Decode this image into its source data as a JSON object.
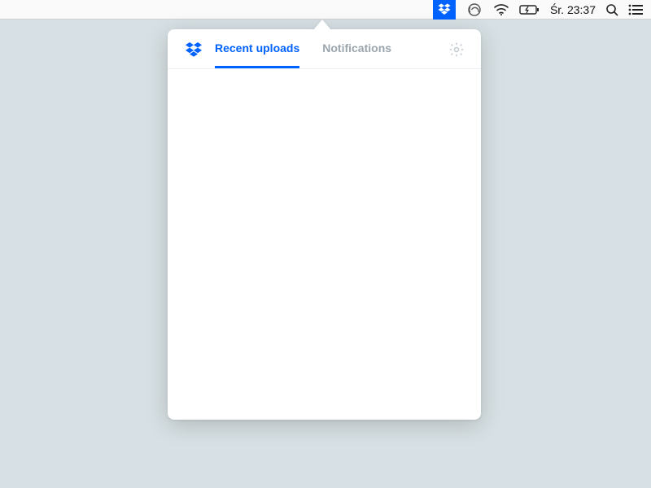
{
  "menubar": {
    "clock": "Śr. 23:37"
  },
  "popover": {
    "tabs": [
      {
        "label": "Recent uploads",
        "active": true
      },
      {
        "label": "Notifications",
        "active": false
      }
    ]
  },
  "colors": {
    "accent": "#0062ff"
  }
}
